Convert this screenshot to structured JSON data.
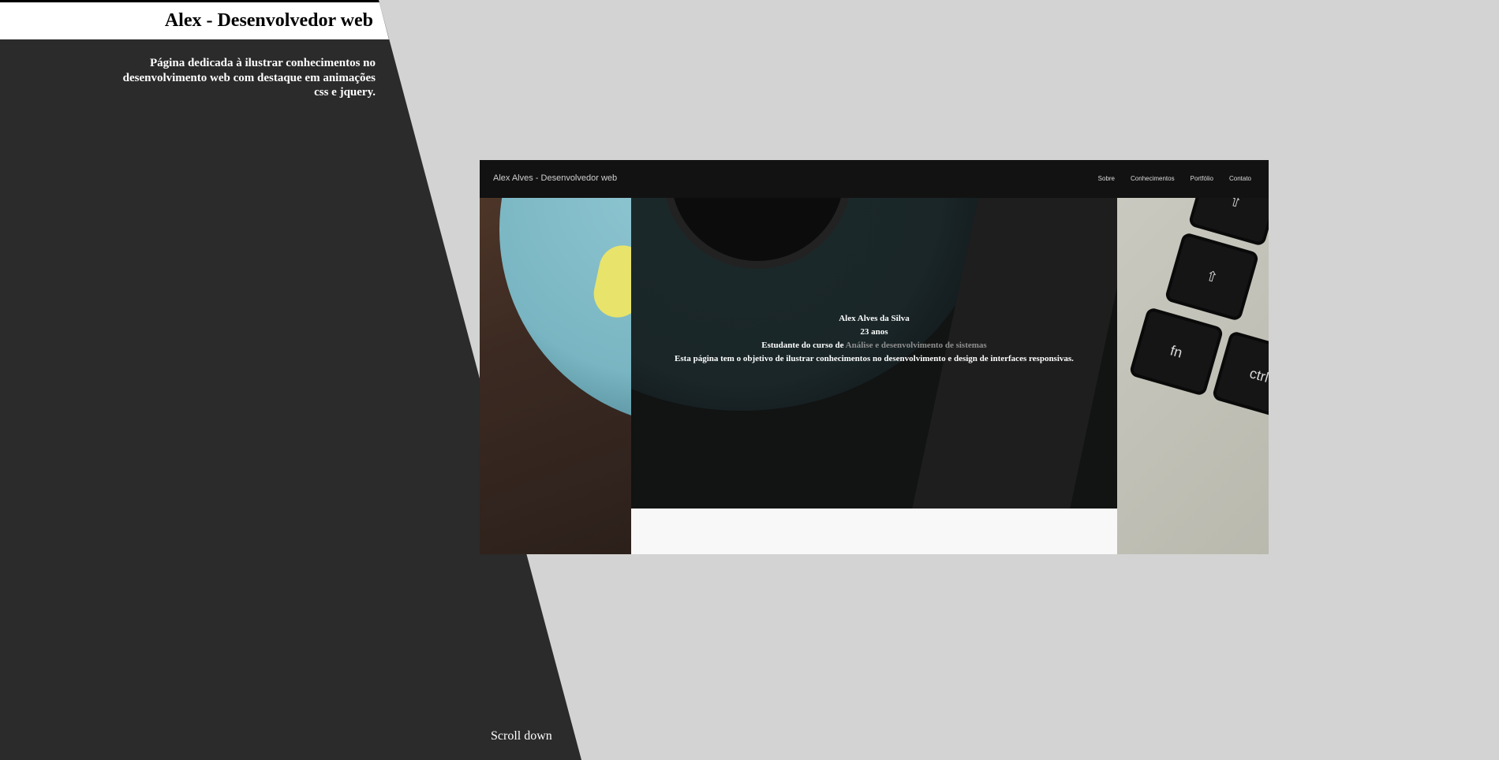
{
  "sidebar": {
    "title": "Alex - Desenvolvedor web",
    "description": "Página dedicada à ilustrar conhecimentos no desenvolvimento web com destaque em animações css e jquery.",
    "scroll_label": "Scroll down"
  },
  "preview": {
    "brand": "Alex Alves - Desenvolvedor web",
    "nav": [
      "Sobre",
      "Conhecimentos",
      "Portfólio",
      "Contato"
    ],
    "name": "Alex Alves da Silva",
    "age": "23 anos",
    "course_prefix": "Estudante do curso de",
    "course": "Análise e desenvolvimento de sistemas",
    "objective": "Esta página tem o objetivo de ilustrar conhecimentos no desenvolvimento e design de interfaces responsivas.",
    "keys": [
      "fn",
      "ctrl"
    ]
  },
  "colors": {
    "background": "#d3d3d3",
    "panel": "#2b2b2b",
    "title_bar": "#ffffff"
  }
}
